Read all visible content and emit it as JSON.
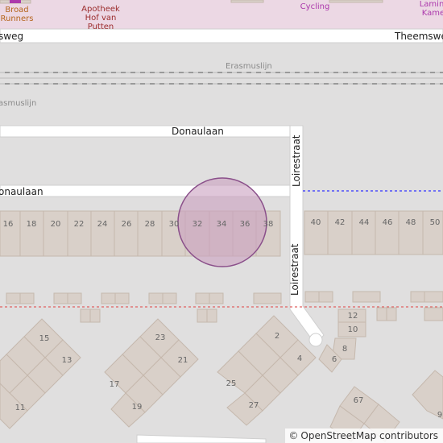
{
  "map": {
    "streets": {
      "theemsweg_left": "sweg",
      "theemsweg_right": "Theemsweg",
      "donaulaan_upper": "Donaulaan",
      "donaulaan_lower": "onaulaan",
      "loirestraat_upper": "Loirestraat",
      "loirestraat_lower": "Loirestraat"
    },
    "railway": {
      "erasmuslijn_upper": "Erasmuslijn",
      "erasmuslijn_lower": "asmuslijn"
    },
    "pois": {
      "broad_runners": [
        "Broad",
        "Runners"
      ],
      "apotheek": [
        "Apotheek",
        "Hof van",
        "Putten"
      ],
      "cycling": "Cycling",
      "lamina": [
        "Lamin",
        "Kame"
      ]
    },
    "house_numbers_row": [
      "16",
      "18",
      "20",
      "22",
      "24",
      "26",
      "28",
      "30",
      "32",
      "34",
      "36",
      "38",
      "40",
      "42",
      "44",
      "46",
      "48",
      "50"
    ],
    "house_numbers_bottom": [
      "15",
      "13",
      "11",
      "23",
      "21",
      "17",
      "19",
      "2",
      "4",
      "25",
      "27",
      "12",
      "10",
      "8",
      "6",
      "67",
      "9"
    ],
    "colors": {
      "residential": "#e0dfdf",
      "road": "#ffffff",
      "building": "#d9d0c9",
      "building_outline": "#c5b8ad",
      "marker_fill": "#c9a0c0",
      "marker_stroke": "#8a4f8a",
      "boundary_blue": "#3030ff",
      "boundary_red": "#e06060",
      "top_area": "#ecd8e4"
    }
  },
  "attribution": {
    "symbol": "©",
    "text": "OpenStreetMap contributors"
  }
}
